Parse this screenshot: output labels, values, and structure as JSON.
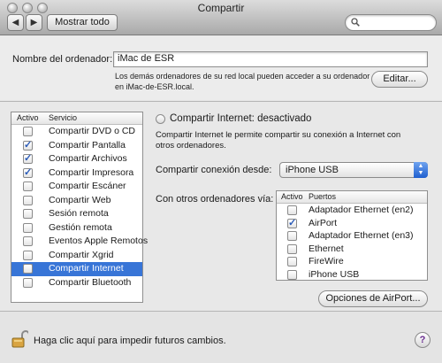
{
  "window": {
    "title": "Compartir"
  },
  "toolbar": {
    "back_icon": "◀",
    "forward_icon": "▶",
    "show_all_label": "Mostrar todo",
    "search_placeholder": ""
  },
  "computer_name": {
    "label": "Nombre del ordenador:",
    "value": "iMac de ESR",
    "note": "Los demás ordenadores de su red local pueden acceder a su ordenador en iMac-de-ESR.local.",
    "edit_label": "Editar..."
  },
  "services": {
    "headers": {
      "active": "Activo",
      "service": "Servicio"
    },
    "items": [
      {
        "label": "Compartir DVD o CD",
        "checked": false,
        "selected": false
      },
      {
        "label": "Compartir Pantalla",
        "checked": true,
        "selected": false
      },
      {
        "label": "Compartir Archivos",
        "checked": true,
        "selected": false
      },
      {
        "label": "Compartir Impresora",
        "checked": true,
        "selected": false
      },
      {
        "label": "Compartir Escáner",
        "checked": false,
        "selected": false
      },
      {
        "label": "Compartir Web",
        "checked": false,
        "selected": false
      },
      {
        "label": "Sesión remota",
        "checked": false,
        "selected": false
      },
      {
        "label": "Gestión remota",
        "checked": false,
        "selected": false
      },
      {
        "label": "Eventos Apple Remotos",
        "checked": false,
        "selected": false
      },
      {
        "label": "Compartir Xgrid",
        "checked": false,
        "selected": false
      },
      {
        "label": "Compartir Internet",
        "checked": false,
        "selected": true
      },
      {
        "label": "Compartir Bluetooth",
        "checked": false,
        "selected": false
      }
    ]
  },
  "detail": {
    "status": "Compartir Internet: desactivado",
    "description": "Compartir Internet le permite compartir su conexión a Internet con otros ordenadores.",
    "share_from_label": "Compartir conexión desde:",
    "share_from_value": "iPhone USB",
    "to_computers_label": "Con otros ordenadores vía:",
    "ports_headers": {
      "active": "Activo",
      "ports": "Puertos"
    },
    "ports": [
      {
        "label": "Adaptador Ethernet (en2)",
        "checked": false
      },
      {
        "label": "AirPort",
        "checked": true
      },
      {
        "label": "Adaptador Ethernet (en3)",
        "checked": false
      },
      {
        "label": "Ethernet",
        "checked": false
      },
      {
        "label": "FireWire",
        "checked": false
      },
      {
        "label": "iPhone USB",
        "checked": false
      }
    ],
    "airport_options_label": "Opciones de AirPort..."
  },
  "footer": {
    "lock_text": "Haga clic aquí para impedir futuros cambios.",
    "help_label": "?"
  },
  "colors": {
    "selection": "#3875d7",
    "checkmark": "#2a5bb8"
  }
}
